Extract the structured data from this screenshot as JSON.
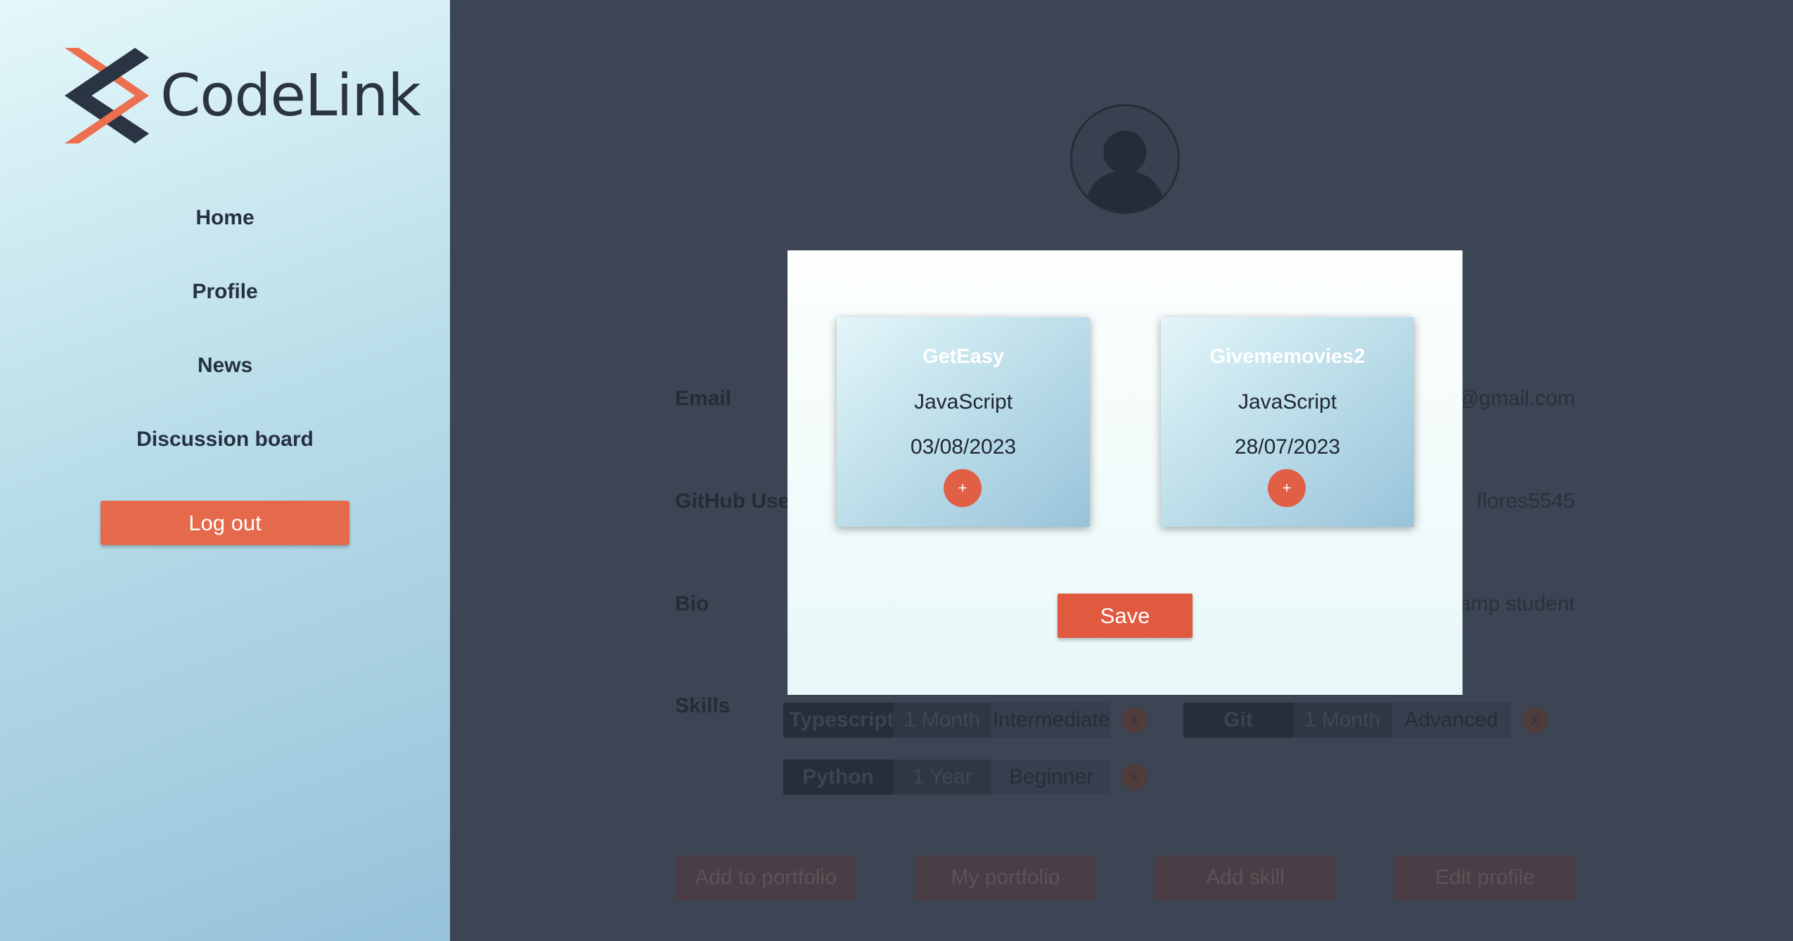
{
  "app": {
    "name": "CodeLink"
  },
  "sidebar": {
    "nav": [
      {
        "label": "Home"
      },
      {
        "label": "Profile"
      },
      {
        "label": "News"
      },
      {
        "label": "Discussion board"
      }
    ],
    "logout_label": "Log out"
  },
  "profile": {
    "fields": [
      {
        "label": "Email",
        "value": "@gmail.com"
      },
      {
        "label": "GitHub User",
        "value": "flores5545"
      },
      {
        "label": "Bio",
        "value": "amp student"
      },
      {
        "label": "Skills"
      }
    ],
    "skills": [
      {
        "name": "Typescript",
        "duration": "1 Month",
        "level": "Intermediate",
        "remove": "x"
      },
      {
        "name": "Git",
        "duration": "1 Month",
        "level": "Advanced",
        "remove": "x"
      },
      {
        "name": "Python",
        "duration": "1 Year",
        "level": "Beginner",
        "remove": "x"
      }
    ],
    "actions": [
      {
        "label": "Add to portfolio"
      },
      {
        "label": "My portfolio"
      },
      {
        "label": "Add skill"
      },
      {
        "label": "Edit profile"
      }
    ]
  },
  "modal": {
    "projects": [
      {
        "title": "GetEasy",
        "language": "JavaScript",
        "date": "03/08/2023",
        "add": "+"
      },
      {
        "title": "Givememovies2",
        "language": "JavaScript",
        "date": "28/07/2023",
        "add": "+"
      }
    ],
    "save_label": "Save"
  },
  "colors": {
    "accent": "#e56a4b",
    "dark": "#2b3442",
    "overlay": "#3c4554"
  }
}
